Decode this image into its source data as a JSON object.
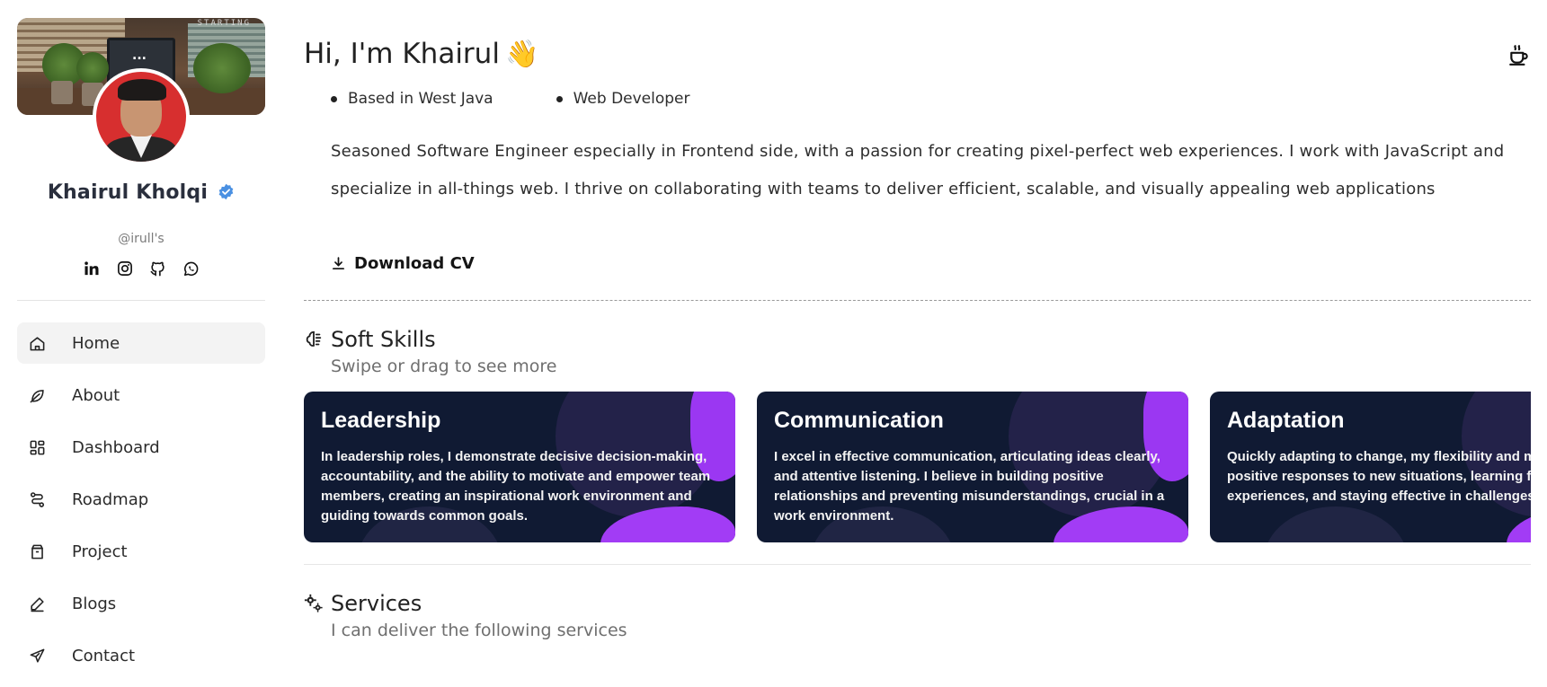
{
  "profile": {
    "cover_stamp": "STARTING",
    "cover_dots": "...",
    "name": "Khairul Kholqi",
    "handle": "@irull's"
  },
  "socials": [
    {
      "icon": "linkedin-icon"
    },
    {
      "icon": "instagram-icon"
    },
    {
      "icon": "github-icon"
    },
    {
      "icon": "whatsapp-icon"
    }
  ],
  "nav": {
    "items": [
      {
        "label": "Home",
        "icon": "home-icon",
        "active": true
      },
      {
        "label": "About",
        "icon": "leaf-icon"
      },
      {
        "label": "Dashboard",
        "icon": "dashboard-icon"
      },
      {
        "label": "Roadmap",
        "icon": "route-icon"
      },
      {
        "label": "Project",
        "icon": "box-icon"
      },
      {
        "label": "Blogs",
        "icon": "pen-icon"
      },
      {
        "label": "Contact",
        "icon": "send-icon"
      }
    ]
  },
  "hero": {
    "greeting": "Hi, I'm Khairul",
    "wave": "👋",
    "facts": [
      "Based in West Java",
      "Web Developer"
    ],
    "bio": "Seasoned Software Engineer especially in Frontend side, with a passion for creating pixel-perfect web experiences. I work with JavaScript and specialize in all-things web. I thrive on collaborating with teams to deliver efficient, scalable, and visually appealing web applications",
    "download_label": "Download CV"
  },
  "soft_skills": {
    "title": "Soft Skills",
    "subtitle": "Swipe or drag to see more",
    "cards": [
      {
        "title": "Leadership",
        "text": "In leadership roles, I demonstrate decisive decision-making, accountability, and the ability to motivate and empower team members, creating an inspirational work environment and guiding towards common goals."
      },
      {
        "title": "Communication",
        "text": "I excel in effective communication, articulating ideas clearly, and attentive listening. I believe in building positive relationships and preventing misunderstandings, crucial in a work environment."
      },
      {
        "title": "Adaptation",
        "text": "Quickly adapting to change, my flexibility and mindset enable positive responses to new situations, learning from experiences, and staying effective in challenges."
      }
    ]
  },
  "services": {
    "title": "Services",
    "subtitle": "I can deliver the following services"
  },
  "colors": {
    "accent_purple": "#9b37f2",
    "card_bg": "#101a33",
    "verified_blue": "#4a90e2"
  }
}
